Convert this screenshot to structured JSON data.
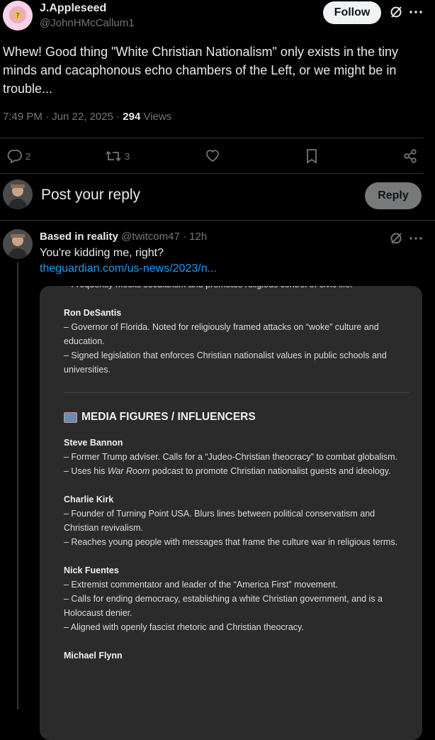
{
  "post": {
    "display_name": "J.Appleseed",
    "handle": "@JohnHMcCallum1",
    "follow_label": "Follow",
    "text": "Whew! Good thing \"White Christian Nationalism\" only exists in the tiny minds and cacaphonous echo chambers of the Left, or we might be in trouble...",
    "time": "7:49 PM · Jun 22, 2025 · ",
    "views_count": "294",
    "views_label": " Views",
    "actions": {
      "replies": "2",
      "reposts": "3"
    }
  },
  "reply_box": {
    "placeholder": "Post your reply",
    "button_label": "Reply"
  },
  "reply": {
    "display_name": "Based in reality",
    "handle_time": "@twitcom47 · 12h",
    "text": "You're kidding me, right?",
    "link": "theguardian.com/us-news/2023/n..."
  },
  "card": {
    "top_cut_line": "– Frequently mocks secularism and promotes religious control of civic life.",
    "entries_top": [
      {
        "name": "Ron DeSantis",
        "lines": [
          "– Governor of Florida. Noted for religiously framed attacks on “woke” culture and education.",
          "– Signed legislation that enforces Christian nationalist values in public schools and universities."
        ]
      }
    ],
    "section_title": "MEDIA FIGURES / INFLUENCERS",
    "section_icon": "television-icon",
    "bannon": {
      "name": "Steve Bannon",
      "line1": "– Former Trump adviser. Calls for a “Judeo-Christian theocracy” to combat globalism.",
      "line2_pre": "– Uses his ",
      "line2_em": "War Room",
      "line2_post": " podcast to promote Christian nationalist guests and ideology."
    },
    "entries_media": [
      {
        "name": "Charlie Kirk",
        "lines": [
          "– Founder of Turning Point USA. Blurs lines between political conservatism and Christian revivalism.",
          "– Reaches young people with messages that frame the culture war in religious terms."
        ]
      },
      {
        "name": "Nick Fuentes",
        "lines": [
          "– Extremist commentator and leader of the “America First” movement.",
          "– Calls for ending democracy, establishing a white Christian government, and is a Holocaust denier.",
          "– Aligned with openly fascist rhetoric and Christian theocracy."
        ]
      }
    ],
    "bottom_cut_name": "Michael Flynn"
  },
  "colors": {
    "background": "#000000",
    "text": "#e7e9ea",
    "muted": "#71767b",
    "link": "#1d9bf0",
    "card_bg": "#2b2b2b"
  }
}
